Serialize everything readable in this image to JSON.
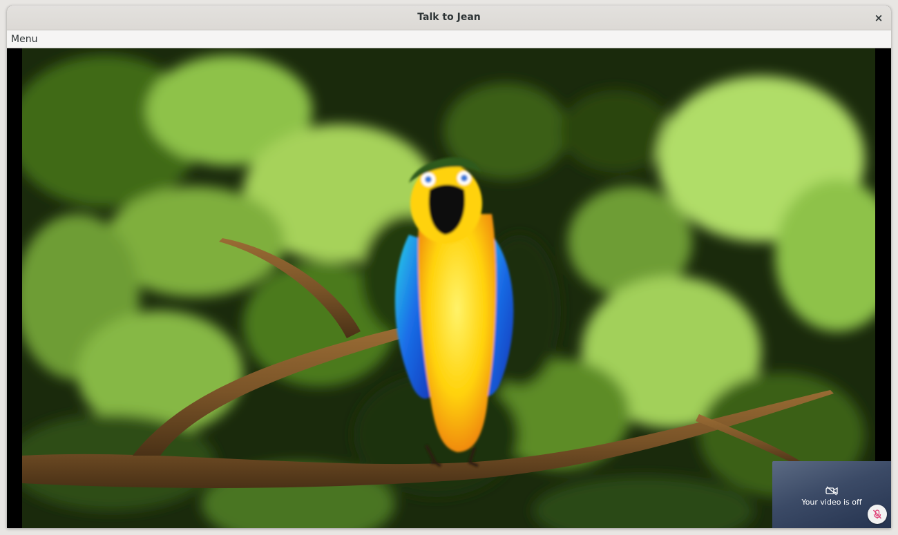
{
  "window": {
    "title": "Talk to Jean",
    "close_glyph": "×"
  },
  "menubar": {
    "menu_label": "Menu"
  },
  "video": {
    "remote_scene": {
      "palette": {
        "leaf_dark": "#0f1a08",
        "leaf_mid": "#4f7a1c",
        "leaf_light": "#a8d85a",
        "branch": "#7a5428",
        "parrot_yellow": "#ffd60a",
        "parrot_blue": "#1a4fd8",
        "parrot_cyan": "#2ad4e8"
      }
    },
    "self_view": {
      "status_text": "Your video is off",
      "camera_icon": "video-off-icon",
      "mic_icon": "mic-muted-icon",
      "mic_color": "#e0447a"
    }
  }
}
